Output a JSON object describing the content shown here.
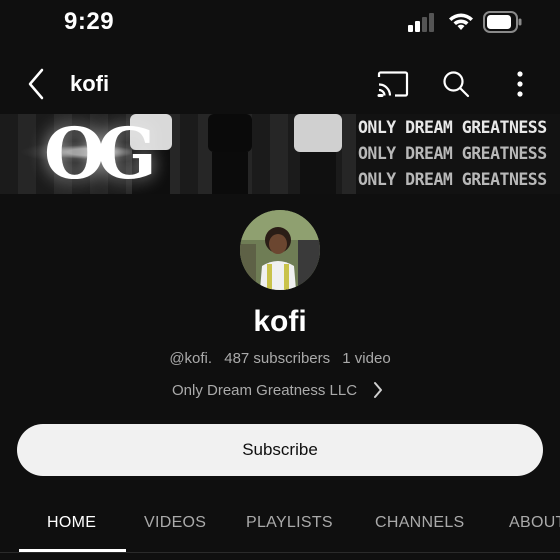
{
  "status_bar": {
    "time": "9:29"
  },
  "app_bar": {
    "title": "kofi",
    "icons": [
      "chevron-left-icon",
      "cast-icon",
      "search-icon",
      "more-vert-icon"
    ]
  },
  "banner": {
    "logo_text": "OG",
    "lines": [
      "ONLY DREAM GREATNESS",
      "ONLY DREAM GREATNESS",
      "ONLY DREAM GREATNESS"
    ]
  },
  "channel": {
    "name": "kofi",
    "handle": "@kofi.",
    "subscribers": "487 subscribers",
    "videos": "1 video",
    "link_text": "Only Dream Greatness LLC"
  },
  "subscribe_label": "Subscribe",
  "tabs": [
    {
      "label": "HOME",
      "active": true
    },
    {
      "label": "VIDEOS"
    },
    {
      "label": "PLAYLISTS"
    },
    {
      "label": "CHANNELS"
    },
    {
      "label": "ABOUT"
    }
  ],
  "colors": {
    "background": "#0f0f0f",
    "text": "#f1f1f1",
    "secondary_text": "#aaaaaa",
    "button": "#f1f1f1"
  }
}
